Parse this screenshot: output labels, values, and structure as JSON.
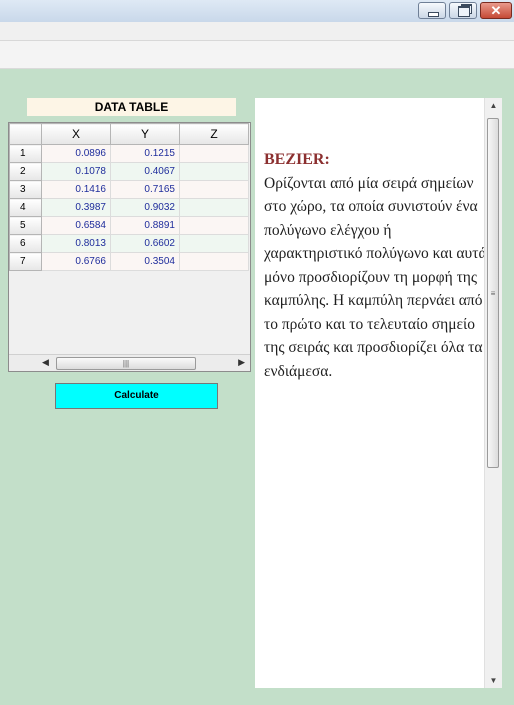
{
  "window": {
    "controls": {
      "minimize_icon": "minimize-icon",
      "maximize_icon": "restore-icon",
      "close_glyph": "✕"
    }
  },
  "data_table": {
    "title": "DATA TABLE",
    "columns": [
      "X",
      "Y",
      "Z"
    ],
    "rows": [
      {
        "n": "1",
        "x": "0.0896",
        "y": "0.1215",
        "z": ""
      },
      {
        "n": "2",
        "x": "0.1078",
        "y": "0.4067",
        "z": ""
      },
      {
        "n": "3",
        "x": "0.1416",
        "y": "0.7165",
        "z": ""
      },
      {
        "n": "4",
        "x": "0.3987",
        "y": "0.9032",
        "z": ""
      },
      {
        "n": "5",
        "x": "0.6584",
        "y": "0.8891",
        "z": ""
      },
      {
        "n": "6",
        "x": "0.8013",
        "y": "0.6602",
        "z": ""
      },
      {
        "n": "7",
        "x": "0.6766",
        "y": "0.3504",
        "z": ""
      }
    ]
  },
  "calculate_label": "Calculate",
  "description": {
    "heading": "BEZIER:",
    "body": "Ορίζονται από μία σειρά σημείων στο χώρο, τα οποία συνιστούν ένα πολύγωνο ελέγχου ή χαρακτηριστικό πολύγωνο και αυτά μόνο προσδιορίζουν τη μορφή της καμπύλης. Η καμπύλη περνάει από το πρώτο και το τελευταίο σημείο της σειράς και προσδιορίζει όλα τα ενδιάμεσα."
  },
  "colors": {
    "background": "#c3dfc9",
    "calculate_button": "#00ffff",
    "heading": "#8b2f2f",
    "cell_text": "#1f2d9c"
  }
}
